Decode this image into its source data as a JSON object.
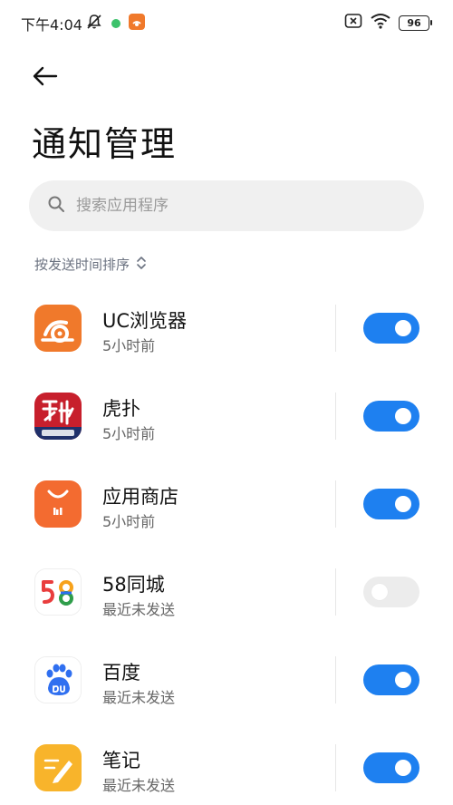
{
  "status_bar": {
    "time": "下午4:04",
    "battery": "96",
    "icons": [
      "mute-icon",
      "dot-icon",
      "uc-notify-icon",
      "sim-x-icon",
      "wifi-icon",
      "battery-icon"
    ]
  },
  "header": {
    "back_icon": "arrow-left-icon",
    "title": "通知管理"
  },
  "search": {
    "placeholder": "搜索应用程序"
  },
  "sort": {
    "label": "按发送时间排序"
  },
  "apps": [
    {
      "name": "UC浏览器",
      "sub": "5小时前",
      "enabled": true,
      "icon": "uc-browser-icon",
      "color": "#f0792b"
    },
    {
      "name": "虎扑",
      "sub": "5小时前",
      "enabled": true,
      "icon": "hupu-icon",
      "color": "#c71f2c"
    },
    {
      "name": "应用商店",
      "sub": "5小时前",
      "enabled": true,
      "icon": "app-store-icon",
      "color": "#f36b30"
    },
    {
      "name": "58同城",
      "sub": "最近未发送",
      "enabled": false,
      "icon": "58-icon",
      "color": "#ffffff"
    },
    {
      "name": "百度",
      "sub": "最近未发送",
      "enabled": true,
      "icon": "baidu-icon",
      "color": "#2f6ff0"
    },
    {
      "name": "笔记",
      "sub": "最近未发送",
      "enabled": true,
      "icon": "notes-icon",
      "color": "#f8b42b"
    }
  ],
  "colors": {
    "accent": "#1e80f0",
    "toggle_off": "#ececec",
    "sort_text": "#6b7280"
  }
}
